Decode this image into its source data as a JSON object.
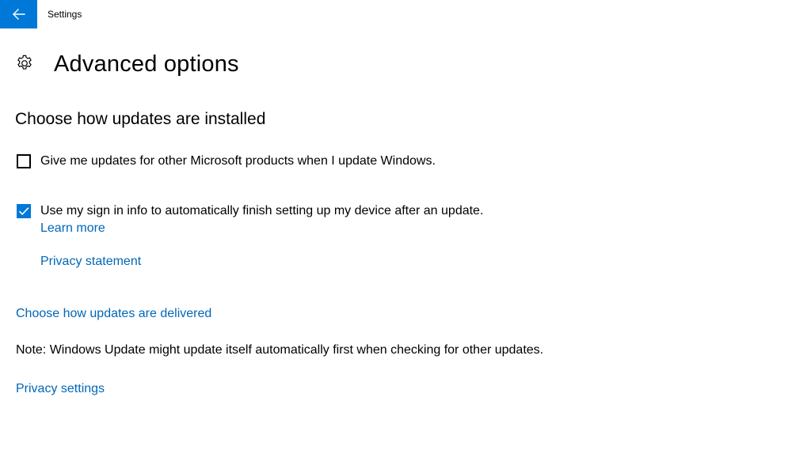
{
  "window": {
    "app_title": "Settings",
    "accent_color": "#0078d7",
    "link_color": "#0067b8"
  },
  "header": {
    "back_icon": "arrow-left-icon",
    "page_icon": "gear-icon",
    "title": "Advanced options"
  },
  "install_section": {
    "title": "Choose how updates are installed",
    "options": [
      {
        "label": "Give me updates for other Microsoft products when I update Windows.",
        "checked": false
      },
      {
        "label": "Use my sign in info to automatically finish setting up my device after an update.",
        "checked": true
      }
    ],
    "learn_more": "Learn more",
    "privacy_statement": "Privacy statement"
  },
  "delivery_link": "Choose how updates are delivered",
  "note": "Note: Windows Update might update itself automatically first when checking for other updates.",
  "privacy_settings_link": "Privacy settings"
}
